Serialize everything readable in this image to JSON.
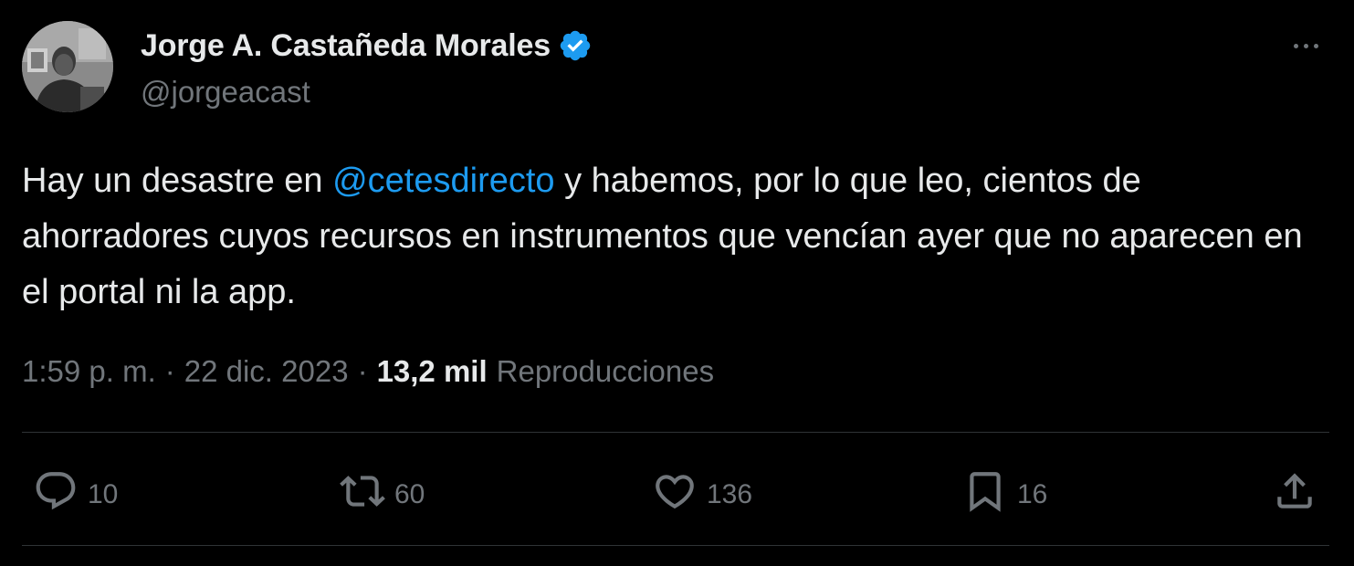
{
  "tweet": {
    "author": {
      "display_name": "Jorge A. Castañeda Morales",
      "handle": "@jorgeacast",
      "verified": true,
      "avatar_icon": "profile-photo"
    },
    "text": {
      "before_mention": "Hay un desastre en ",
      "mention": "@cetesdirecto",
      "after_mention": " y habemos, por lo que leo, cientos de ahorradores cuyos recursos en instrumentos que vencían ayer que no aparecen en el portal ni la app."
    },
    "meta": {
      "time": "1:59 p. m.",
      "separator": "·",
      "date": "22 dic. 2023",
      "views_count": "13,2 mil",
      "views_label": "Reproducciones"
    },
    "actions": {
      "replies": "10",
      "reposts": "60",
      "likes": "136",
      "bookmarks": "16"
    },
    "icons": {
      "more": "more-horizontal-icon",
      "verified": "verified-badge-icon",
      "reply": "reply-icon",
      "repost": "repost-icon",
      "like": "heart-icon",
      "bookmark": "bookmark-icon",
      "share": "share-icon"
    },
    "colors": {
      "background": "#000000",
      "primary_text": "#e7e9ea",
      "secondary_text": "#71767b",
      "accent": "#1d9bf0",
      "divider": "#2f3336"
    }
  }
}
